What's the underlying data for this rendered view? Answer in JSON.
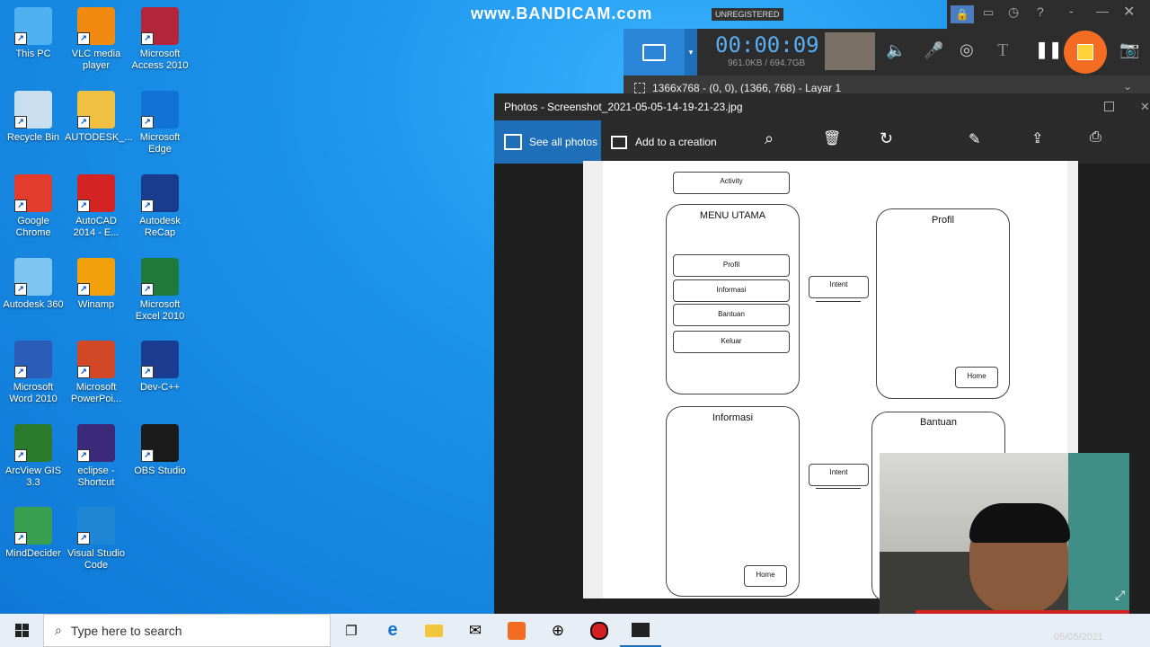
{
  "desktop_icons": [
    {
      "label": "This PC",
      "icon": "this-pc-icon",
      "color": "#4fb1f0"
    },
    {
      "label": "VLC media player",
      "icon": "vlc-icon",
      "color": "#f08a10"
    },
    {
      "label": "Microsoft Access 2010",
      "icon": "access-icon",
      "color": "#b3263a"
    },
    {
      "label": "Recycle Bin",
      "icon": "recycle-bin-icon",
      "color": "#c9dff0"
    },
    {
      "label": "AUTODESK_...",
      "icon": "folder-icon",
      "color": "#f0c040"
    },
    {
      "label": "Microsoft Edge",
      "icon": "edge-icon",
      "color": "#1173d4"
    },
    {
      "label": "Google Chrome",
      "icon": "chrome-icon",
      "color": "#e33b2e"
    },
    {
      "label": "AutoCAD 2014 - E...",
      "icon": "autocad-icon",
      "color": "#d32323"
    },
    {
      "label": "Autodesk ReCap",
      "icon": "recap-icon",
      "color": "#1a3c8c"
    },
    {
      "label": "Autodesk 360",
      "icon": "autodesk360-icon",
      "color": "#7ec6f0"
    },
    {
      "label": "Winamp",
      "icon": "winamp-icon",
      "color": "#f2a10c"
    },
    {
      "label": "Microsoft Excel 2010",
      "icon": "excel-icon",
      "color": "#1f7a3a"
    },
    {
      "label": "Microsoft Word 2010",
      "icon": "word-icon",
      "color": "#2b5cb8"
    },
    {
      "label": "Microsoft PowerPoi...",
      "icon": "powerpoint-icon",
      "color": "#d24726"
    },
    {
      "label": "Dev-C++",
      "icon": "devcpp-icon",
      "color": "#1c3d8f"
    },
    {
      "label": "ArcView GIS 3.3",
      "icon": "arcview-icon",
      "color": "#2c7a2c"
    },
    {
      "label": "eclipse - Shortcut",
      "icon": "eclipse-icon",
      "color": "#3b2a7a"
    },
    {
      "label": "OBS Studio",
      "icon": "obs-icon",
      "color": "#1a1a1a"
    },
    {
      "label": "MindDecider",
      "icon": "minddecider-icon",
      "color": "#38a050"
    },
    {
      "label": "Visual Studio Code",
      "icon": "vscode-icon",
      "color": "#1f86d6"
    }
  ],
  "bandicam": {
    "watermark": "www.BANDICAM.com",
    "badge": "UNREGISTERED",
    "timer": "00:00:09",
    "size": "961.0KB / 694.7GB",
    "region": "1366x768 - (0, 0), (1366, 768) - Layar 1",
    "accent": "#f26d21"
  },
  "photos": {
    "title": "Photos - Screenshot_2021-05-05-14-19-21-23.jpg",
    "see_all": "See all photos",
    "add_creation": "Add to a creation"
  },
  "diagram": {
    "activity": "Activity",
    "menu_title": "MENU UTAMA",
    "menu_items": [
      "Profil",
      "Informasi",
      "Bantuan",
      "Keluar"
    ],
    "intent1": "Intent",
    "intent2": "Intent",
    "profil_title": "Profil",
    "profil_home": "Home",
    "info_title": "Informasi",
    "info_home": "Home",
    "bantuan_title": "Bantuan"
  },
  "taskbar": {
    "search_placeholder": "Type here to search",
    "date": "05/05/2021"
  }
}
